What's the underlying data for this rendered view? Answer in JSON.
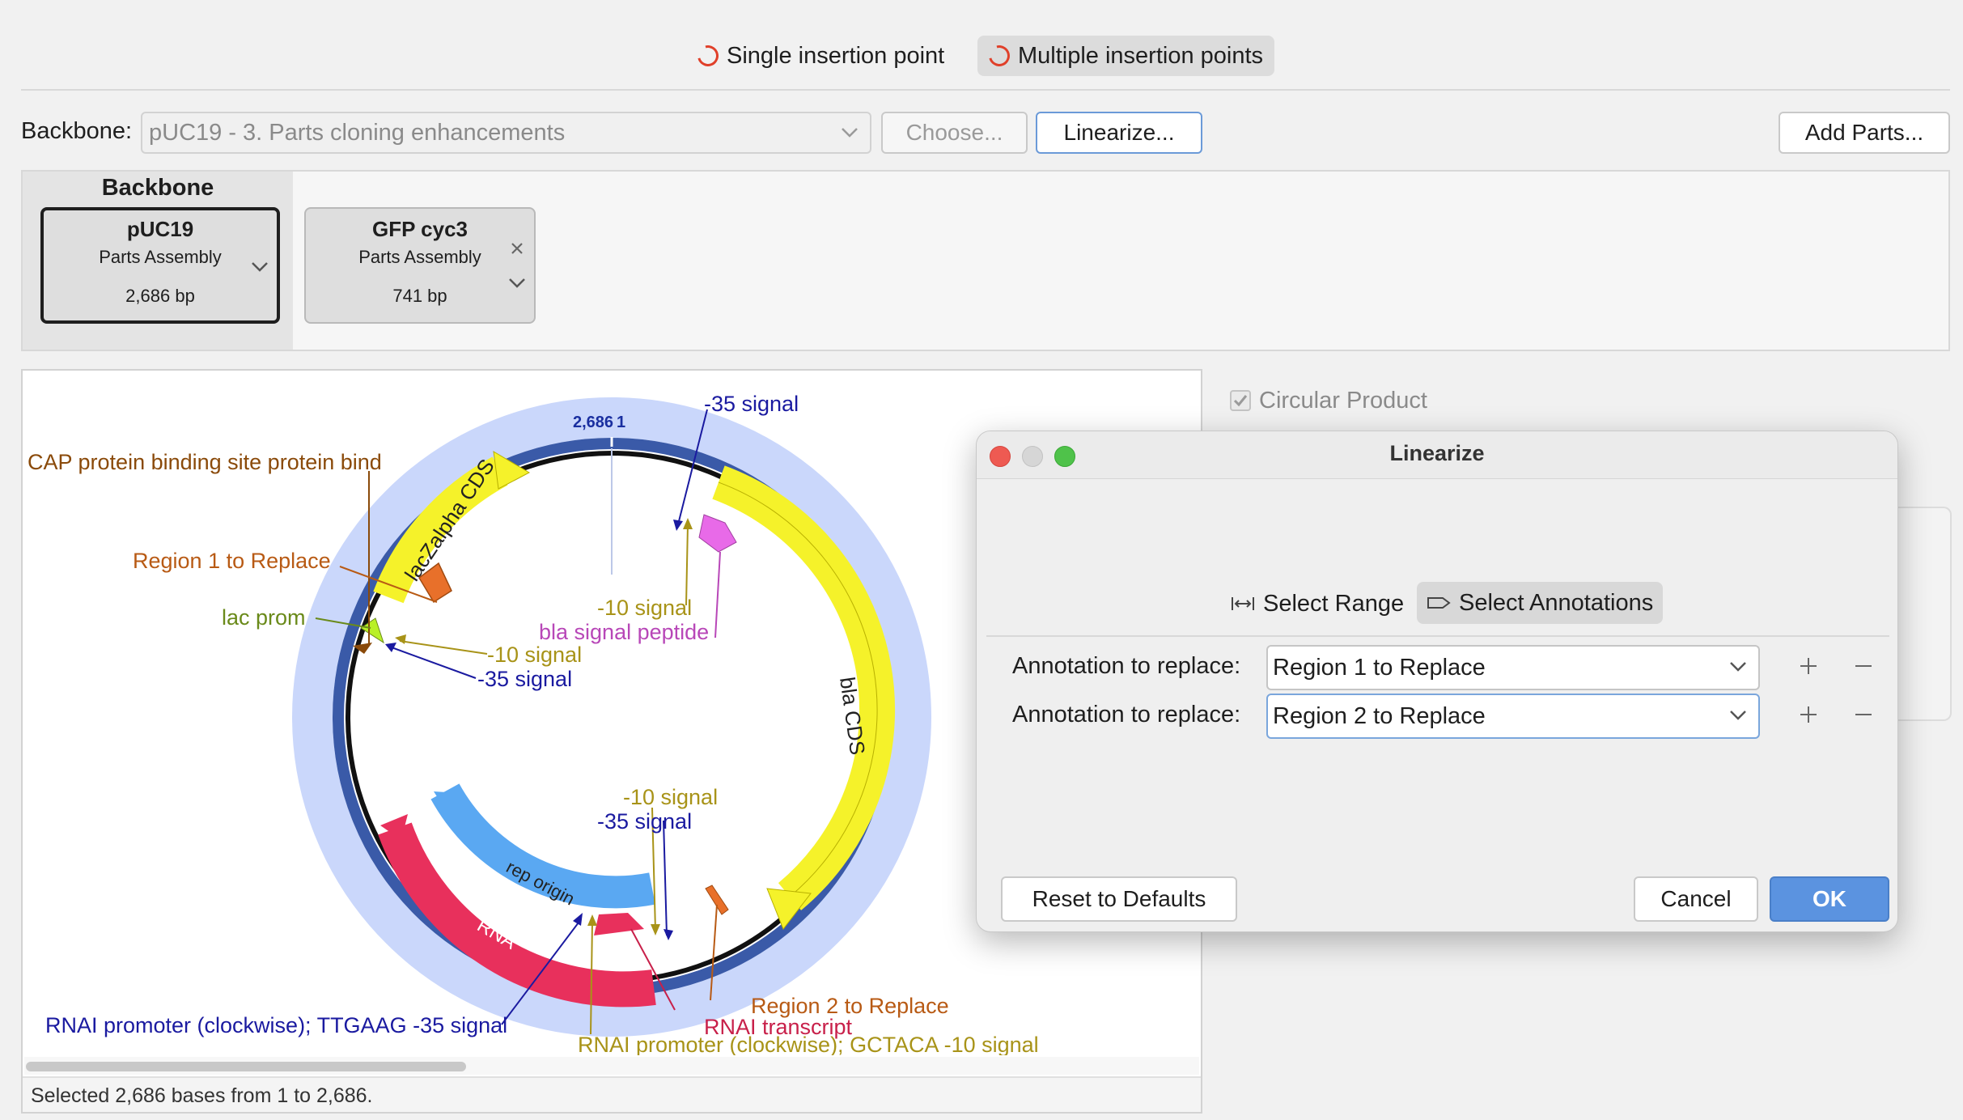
{
  "insertion_toggle": {
    "single_label": "Single insertion point",
    "multiple_label": "Multiple insertion points",
    "selected": "multiple"
  },
  "backbone_row": {
    "label": "Backbone:",
    "value": "pUC19 - 3. Parts cloning enhancements",
    "choose_label": "Choose...",
    "linearize_label": "Linearize...",
    "add_parts_label": "Add Parts..."
  },
  "parts": {
    "backbone_header": "Backbone",
    "cards": [
      {
        "name": "pUC19",
        "type": "Parts Assembly",
        "size": "2,686 bp"
      },
      {
        "name": "GFP cyc3",
        "type": "Parts Assembly",
        "size": "741 bp"
      }
    ]
  },
  "circular_product_label": "Circular Product",
  "status_text": "Selected 2,686 bases from 1 to 2,686.",
  "plasmid_map": {
    "top_position_label": "2,686",
    "origin_label": "1",
    "feature_labels": {
      "lacZalpha": "lacZalpha CDS",
      "bla": "bla CDS",
      "rep": "rep origin",
      "rna": "RNA"
    },
    "annotations": [
      {
        "text": "CAP protein binding site protein bind",
        "color": "#8a4a0a"
      },
      {
        "text": "Region 1 to Replace",
        "color": "#b85a14"
      },
      {
        "text": "lac prom",
        "color": "#6a8a1a"
      },
      {
        "text": "-10 signal",
        "color": "#a89318"
      },
      {
        "text": "-35 signal",
        "color": "#1a1aa0"
      },
      {
        "text": "-35 signal",
        "color": "#1a1aa0"
      },
      {
        "text": "-10 signal",
        "color": "#a89318"
      },
      {
        "text": "bla signal peptide",
        "color": "#b847b8"
      },
      {
        "text": "-10 signal",
        "color": "#a89318"
      },
      {
        "text": "-35 signal",
        "color": "#1a1aa0"
      },
      {
        "text": "Region 2 to Replace",
        "color": "#b85a14"
      },
      {
        "text": "RNAI transcript",
        "color": "#c8204a"
      },
      {
        "text": "RNAI promoter (clockwise); TTGAAG -35 signal",
        "color": "#1a1aa0"
      },
      {
        "text": "RNAI promoter (clockwise); GCTACA -10 signal",
        "color": "#a89318"
      }
    ]
  },
  "dialog": {
    "title": "Linearize",
    "mode_range": "Select Range",
    "mode_annotations": "Select Annotations",
    "rows": [
      {
        "label": "Annotation to replace:",
        "value": "Region 1 to Replace"
      },
      {
        "label": "Annotation to replace:",
        "value": "Region 2 to Replace"
      }
    ],
    "reset_label": "Reset to Defaults",
    "cancel_label": "Cancel",
    "ok_label": "OK"
  }
}
